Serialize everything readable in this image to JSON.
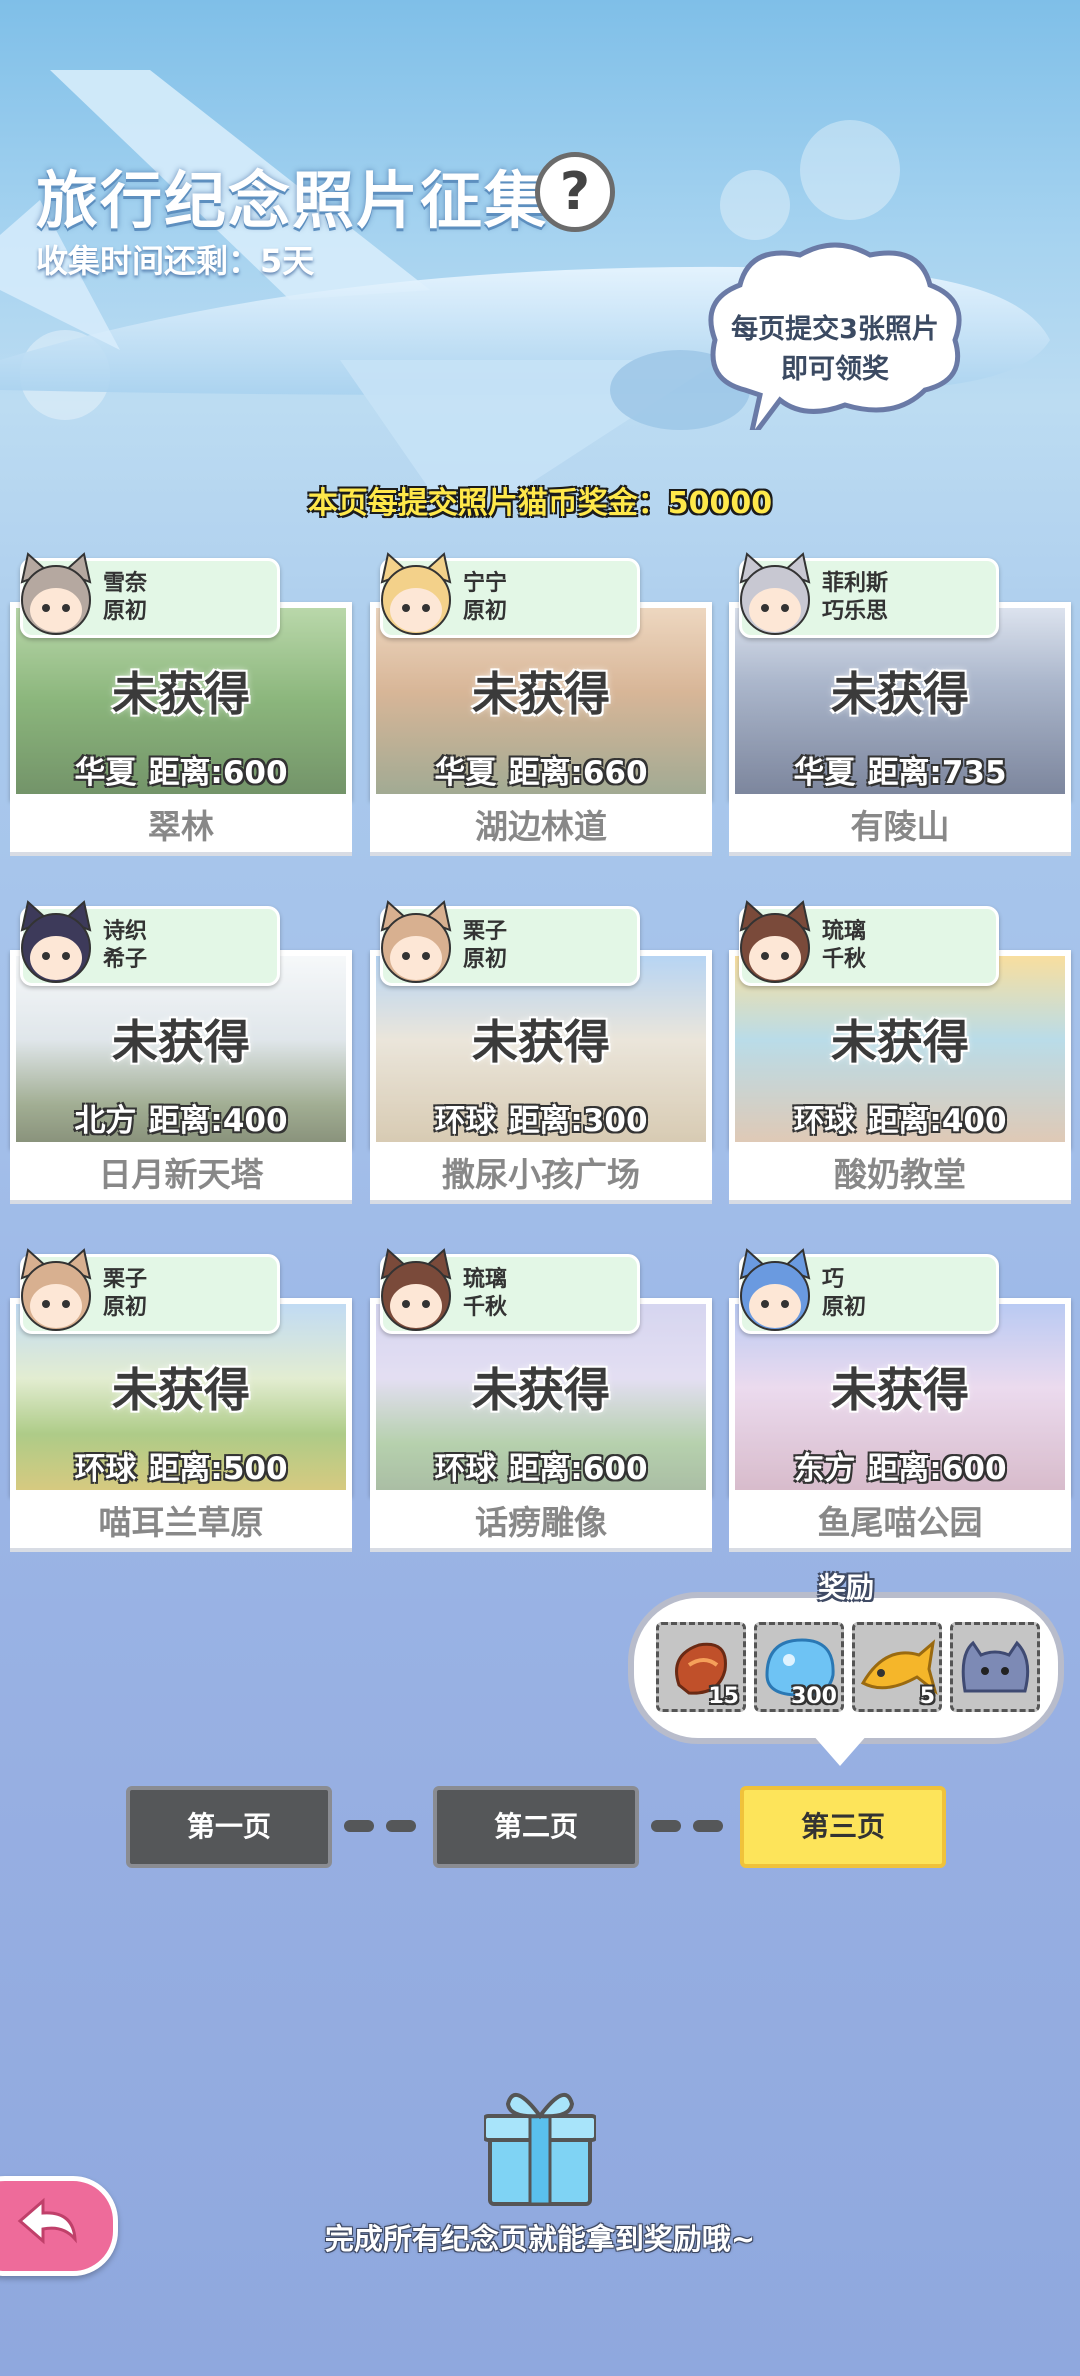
{
  "header": {
    "title": "旅行纪念照片征集",
    "help_icon": "?",
    "countdown": "收集时间还剩：5天",
    "bubble_line1": "每页提交3张照片",
    "bubble_line2": "即可领奖",
    "bonus": "本页每提交照片猫币奖金：50000"
  },
  "status_text": "未获得",
  "distance_label": "距离:",
  "cards": [
    {
      "char_line1": "雪奈",
      "char_line2": "原初",
      "region": "华夏",
      "distance": "600",
      "name": "翠林",
      "scene": "forest"
    },
    {
      "char_line1": "宁宁",
      "char_line2": "原初",
      "region": "华夏",
      "distance": "660",
      "name": "湖边林道",
      "scene": "lake"
    },
    {
      "char_line1": "菲利斯",
      "char_line2": "巧乐思",
      "region": "华夏",
      "distance": "735",
      "name": "有陵山",
      "scene": "mountain"
    },
    {
      "char_line1": "诗织",
      "char_line2": "希子",
      "region": "北方",
      "distance": "400",
      "name": "日月新天塔",
      "scene": "plain"
    },
    {
      "char_line1": "栗子",
      "char_line2": "原初",
      "region": "环球",
      "distance": "300",
      "name": "撒尿小孩广场",
      "scene": "square"
    },
    {
      "char_line1": "琉璃",
      "char_line2": "千秋",
      "region": "环球",
      "distance": "400",
      "name": "酸奶教堂",
      "scene": "church"
    },
    {
      "char_line1": "栗子",
      "char_line2": "原初",
      "region": "环球",
      "distance": "500",
      "name": "喵耳兰草原",
      "scene": "grass"
    },
    {
      "char_line1": "琉璃",
      "char_line2": "千秋",
      "region": "环球",
      "distance": "600",
      "name": "话痨雕像",
      "scene": "statue"
    },
    {
      "char_line1": "巧",
      "char_line2": "原初",
      "region": "东方",
      "distance": "600",
      "name": "鱼尾喵公园",
      "scene": "park"
    }
  ],
  "rewards": {
    "title": "奖励",
    "items": [
      {
        "icon": "dried-fish-icon",
        "count": "15"
      },
      {
        "icon": "blue-slime-icon",
        "count": "300"
      },
      {
        "icon": "gold-fish-icon",
        "count": "5"
      },
      {
        "icon": "cat-plush-icon",
        "count": ""
      }
    ]
  },
  "pages": {
    "p1": "第一页",
    "p2": "第二页",
    "p3": "第三页",
    "active": "第三页"
  },
  "footer": "完成所有纪念页就能拿到奖励哦~"
}
